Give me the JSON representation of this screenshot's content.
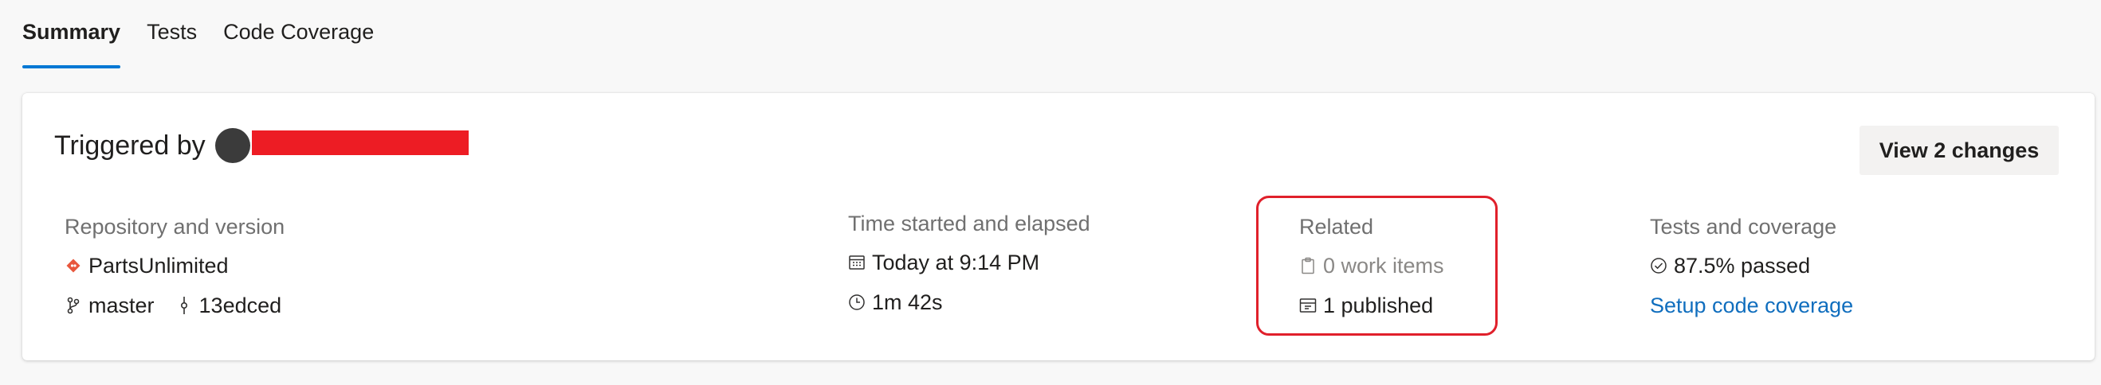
{
  "tabs": [
    {
      "label": "Summary",
      "active": true
    },
    {
      "label": "Tests",
      "active": false
    },
    {
      "label": "Code Coverage",
      "active": false
    }
  ],
  "header": {
    "triggered_label": "Triggered by",
    "view_changes_label": "View 2 changes"
  },
  "repository": {
    "label": "Repository and version",
    "repo_name": "PartsUnlimited",
    "branch": "master",
    "commit": "13edced"
  },
  "time": {
    "label": "Time started and elapsed",
    "started": "Today at 9:14 PM",
    "elapsed": "1m 42s"
  },
  "related": {
    "label": "Related",
    "work_items": "0 work items",
    "published": "1 published"
  },
  "tests": {
    "label": "Tests and coverage",
    "passed": "87.5% passed",
    "setup_link": "Setup code coverage"
  },
  "colors": {
    "accent": "#0078d4",
    "link": "#106ebe",
    "highlight": "#e0202b",
    "redaction": "#ed1c24",
    "repo_icon": "#e8573d"
  }
}
